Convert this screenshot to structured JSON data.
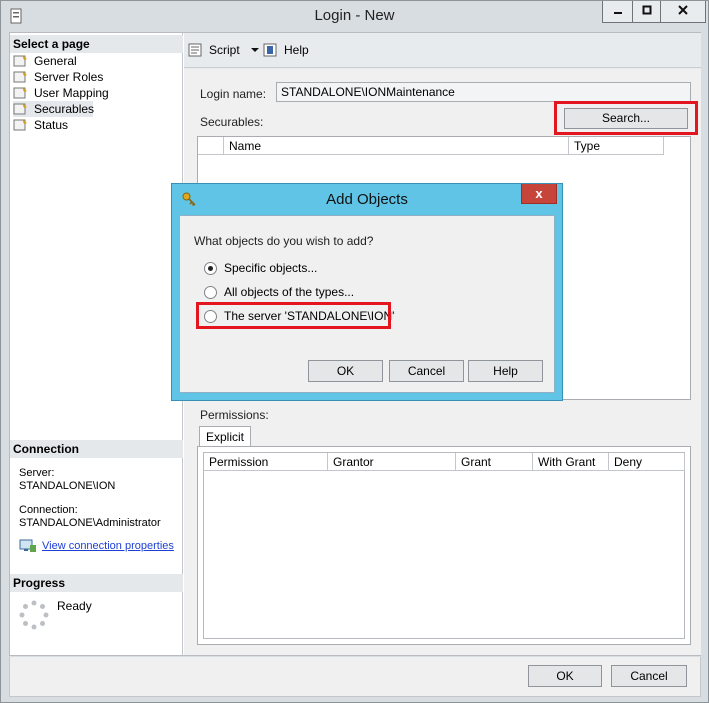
{
  "window": {
    "title": "Login - New"
  },
  "left": {
    "select_page_header": "Select a page",
    "pages": [
      "General",
      "Server Roles",
      "User Mapping",
      "Securables",
      "Status"
    ],
    "selected_page": "Securables",
    "connection_header": "Connection",
    "server_label": "Server:",
    "server_value": "STANDALONE\\ION",
    "connection_label": "Connection:",
    "connection_value": "STANDALONE\\Administrator",
    "view_connection_link": "View connection properties",
    "progress_header": "Progress",
    "progress_status": "Ready"
  },
  "toolbar": {
    "script_label": "Script",
    "help_label": "Help"
  },
  "form": {
    "login_name_label": "Login name:",
    "login_name_value": "STANDALONE\\IONMaintenance",
    "securables_label": "Securables:",
    "search_button": "Search...",
    "securables_columns": [
      "Name",
      "Type"
    ],
    "permissions_label": "Permissions:",
    "tab_explicit": "Explicit",
    "permission_columns": [
      "Permission",
      "Grantor",
      "Grant",
      "With Grant",
      "Deny"
    ]
  },
  "footer": {
    "ok": "OK",
    "cancel": "Cancel"
  },
  "dialog": {
    "title": "Add Objects",
    "close_glyph": "x",
    "question": "What objects do you wish to add?",
    "options": [
      "Specific objects...",
      "All objects of the types...",
      "The server 'STANDALONE\\ION'"
    ],
    "selected_option": "Specific objects...",
    "ok": "OK",
    "cancel": "Cancel",
    "help": "Help"
  },
  "colors": {
    "highlight": "#e3161f",
    "dialog_frame": "#5fc4e6",
    "link": "#1d3fd6"
  }
}
